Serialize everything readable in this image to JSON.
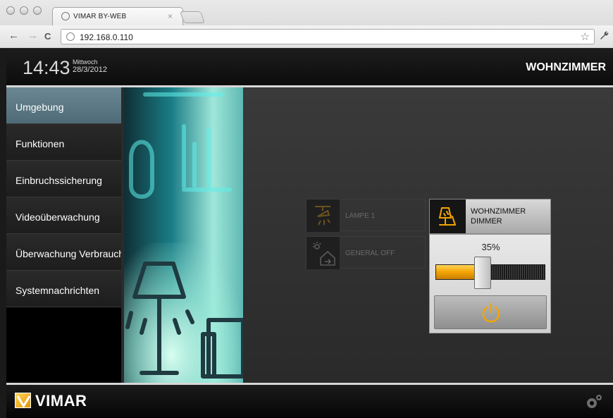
{
  "browser": {
    "tab_title": "VIMAR BY-WEB",
    "tab_close": "×",
    "url": "192.168.0.110",
    "back": "←",
    "forward": "→",
    "reload": "C",
    "star": "☆",
    "wrench": "🔧"
  },
  "header": {
    "time": "14:43",
    "weekday": "Mittwoch",
    "date": "28/3/2012",
    "room": "WOHNZIMMER"
  },
  "sidebar": {
    "items": [
      {
        "label": "Umgebung",
        "active": true
      },
      {
        "label": "Funktionen"
      },
      {
        "label": "Einbruchssicherung"
      },
      {
        "label": "Videoüberwachung"
      },
      {
        "label": "Überwachung Verbrauch"
      },
      {
        "label": "Systemnachrichten"
      }
    ]
  },
  "devices": {
    "lamp": {
      "label": "LAMPE 1",
      "icon": "ceiling-lamp-icon"
    },
    "general": {
      "label": "GENERAL OFF",
      "icon": "house-off-icon"
    },
    "dimmer": {
      "label_line1": "WOHNZIMMER",
      "label_line2": "DIMMER",
      "icon": "dimmer-lamp-icon",
      "level_percent": 35,
      "level_text": "35%",
      "power_icon": "power-icon"
    }
  },
  "footer": {
    "brand": "VIMAR",
    "settings_icon": "gears-icon"
  },
  "colors": {
    "accent": "#f3a400",
    "active_menu": "#5f7c88",
    "header_bg": "#111111"
  }
}
